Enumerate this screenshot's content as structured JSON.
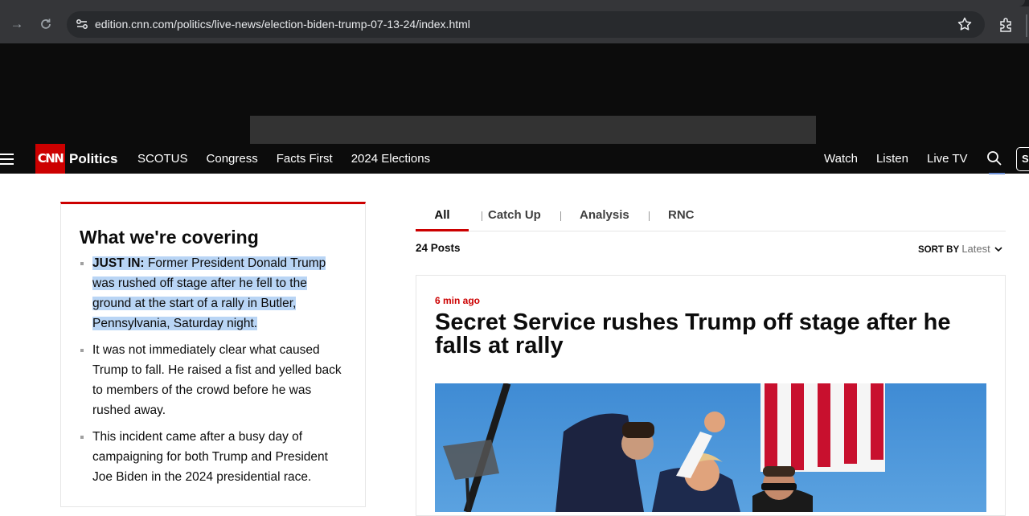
{
  "browser": {
    "url": "edition.cnn.com/politics/live-news/election-biden-trump-07-13-24/index.html"
  },
  "header": {
    "logo_text": "CNN",
    "section": "Politics",
    "nav_left": [
      "SCOTUS",
      "Congress",
      "Facts First",
      "2024 Elections"
    ],
    "nav_right": [
      "Watch",
      "Listen",
      "Live TV"
    ],
    "signin_label": "S"
  },
  "covering": {
    "title": "What we're covering",
    "items": [
      {
        "lead": "JUST IN:",
        "text": " Former President Donald Trump was rushed off stage after he fell to the ground at the start of a rally in Butler, Pennsylvania, Saturday night."
      },
      {
        "lead": "",
        "text": "It was not immediately clear what caused Trump to fall. He raised a fist and yelled back to members of the crowd before he was rushed away."
      },
      {
        "lead": "",
        "text": "This incident came after a busy day of campaigning for both Trump and President Joe Biden in the 2024 presidential race."
      }
    ]
  },
  "tabs": [
    {
      "label": "All",
      "active": true
    },
    {
      "label": "Catch Up",
      "active": false
    },
    {
      "label": "Analysis",
      "active": false
    },
    {
      "label": "RNC",
      "active": false
    }
  ],
  "feed": {
    "posts_count": "24 Posts",
    "sort_label": "SORT BY",
    "sort_value": "Latest"
  },
  "post": {
    "time": "6 min ago",
    "headline": "Secret Service rushes Trump off stage after he falls at rally"
  },
  "colors": {
    "brand_red": "#cc0000",
    "header_bg": "#0c0c0c",
    "highlight": "#b9d5f5"
  }
}
